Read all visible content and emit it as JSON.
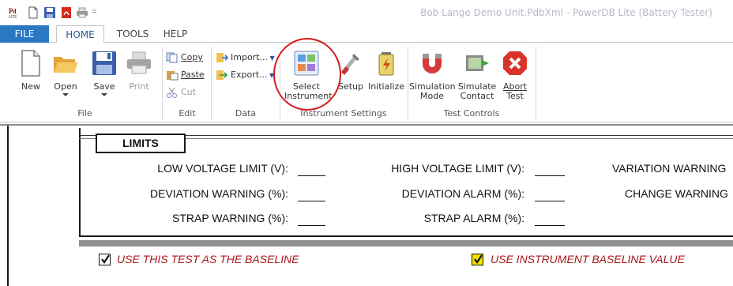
{
  "window": {
    "title": "Bob Lange Demo Unit.PdbXml - PowerDB Lite (Battery Tester)"
  },
  "quick_access": {
    "items": [
      "app-logo-icon",
      "new-doc-icon",
      "save-disk-icon",
      "pdf-icon",
      "print-icon",
      "customize-dropdown-icon"
    ],
    "dropdown_glyph": "="
  },
  "tabs": [
    {
      "label": "FILE",
      "active": false
    },
    {
      "label": "HOME",
      "active": true
    },
    {
      "label": "TOOLS",
      "active": false
    },
    {
      "label": "HELP",
      "active": false
    }
  ],
  "ribbon": {
    "file_group": {
      "label": "File",
      "new": "New",
      "open": "Open",
      "save": "Save",
      "print": "Print"
    },
    "edit_group": {
      "label": "Edit",
      "copy": "Copy",
      "paste": "Paste",
      "cut": "Cut"
    },
    "data_group": {
      "label": "Data",
      "import": "Import...",
      "export": "Export..."
    },
    "instrument_group": {
      "label": "Instrument Settings",
      "select_line1": "Select",
      "select_line2": "Instrument",
      "setup": "Setup",
      "initialize": "Initialize"
    },
    "test_group": {
      "label": "Test Controls",
      "simulation_line1": "Simulation",
      "simulation_line2": "Mode",
      "simulate_line1": "Simulate",
      "simulate_line2": "Contact",
      "abort_line1": "Abort",
      "abort_line2": "Test"
    }
  },
  "colors": {
    "file_tab": "#2b78c2",
    "annotation_circle": "#d21c1c",
    "checkbox_label": "#a8181c",
    "baseline_instrument_checkbox": "#f4e100"
  },
  "limits": {
    "header": "LIMITS",
    "low_voltage": "LOW  VOLTAGE LIMIT (V):",
    "high_voltage": "HIGH VOLTAGE LIMIT (V):",
    "variation_warning": "VARIATION WARNING",
    "deviation_warning": "DEVIATION WARNING (%):",
    "deviation_alarm": "DEVIATION ALARM (%):",
    "change_warning": "CHANGE WARNING",
    "strap_warning": "STRAP WARNING (%):",
    "strap_alarm": "STRAP ALARM (%):"
  },
  "options": {
    "use_as_baseline": {
      "label": "USE THIS TEST AS THE BASELINE",
      "checked": true
    },
    "use_instrument_baseline": {
      "label": "USE INSTRUMENT BASELINE VALUE",
      "checked": true
    }
  }
}
